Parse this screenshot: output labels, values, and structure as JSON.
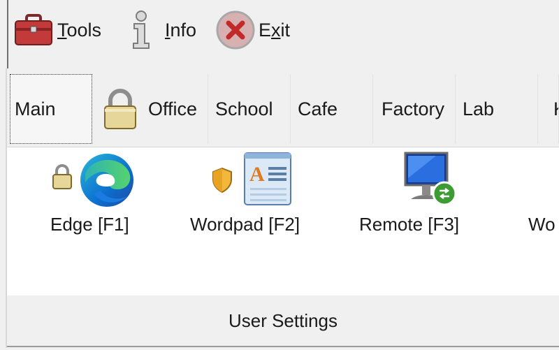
{
  "menu": {
    "tools": {
      "prefix": "",
      "accel": "T",
      "rest": "ools",
      "icon": "toolbox-icon"
    },
    "info": {
      "prefix": "",
      "accel": "I",
      "rest": "nfo",
      "icon": "info-icon"
    },
    "exit": {
      "prefix": "E",
      "accel": "x",
      "rest": "it",
      "icon": "close-circle-icon"
    }
  },
  "tabs": [
    {
      "label": "Main",
      "active": true
    },
    {
      "label": "Office",
      "icon": "padlock-icon"
    },
    {
      "label": "School"
    },
    {
      "label": "Cafe"
    },
    {
      "label": "Factory"
    },
    {
      "label": "Lab"
    },
    {
      "label": "K"
    }
  ],
  "apps": [
    {
      "label": "Edge [F1]",
      "icon": "edge-icon",
      "badge": "lock-icon"
    },
    {
      "label": "Wordpad [F2]",
      "icon": "wordpad-icon",
      "badge": "shield-icon"
    },
    {
      "label": "Remote [F3]",
      "icon": "remote-desktop-icon"
    },
    {
      "label": "Wo"
    }
  ],
  "footer": {
    "settings_label": "User Settings"
  },
  "colors": {
    "menubar_bg": "#f0f0f0",
    "panel_bg": "#ffffff",
    "edge_blue": "#0c6fd0",
    "edge_green": "#32c17a"
  }
}
